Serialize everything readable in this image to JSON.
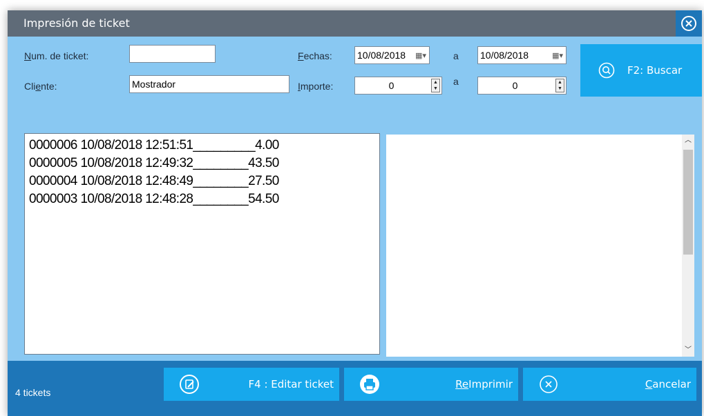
{
  "window": {
    "title": "Impresión de ticket",
    "close_icon": "close-circle-icon"
  },
  "filters": {
    "ticket_label_u": "N",
    "ticket_label_rest": "um. de ticket:",
    "ticket_value": "",
    "client_label_pre": "Cli",
    "client_label_u": "e",
    "client_label_post": "nte:",
    "client_value": "Mostrador",
    "dates_label_u": "F",
    "dates_label_rest": "echas:",
    "date_from": "10/08/2018",
    "date_to": "10/08/2018",
    "amount_label_u": "I",
    "amount_label_rest": "mporte:",
    "amount_from": "0",
    "amount_to": "0",
    "sep": "a"
  },
  "search_button": {
    "label": "F2: Buscar",
    "icon": "search-icon"
  },
  "tickets": [
    "0000006 10/08/2018 12:51:51_________4.00",
    "0000005 10/08/2018 12:49:32________43.50",
    "0000004 10/08/2018 12:48:49________27.50",
    "0000003 10/08/2018 12:48:28________54.50"
  ],
  "footer": {
    "count": "4 tickets",
    "edit_label": "F4 : Editar ticket",
    "edit_icon": "edit-icon",
    "reprint_u": "Re",
    "reprint_rest": "Imprimir",
    "reprint_icon": "printer-icon",
    "cancel_u": "C",
    "cancel_rest": "ancelar",
    "cancel_icon": "cancel-circle-icon"
  },
  "colors": {
    "panel": "#89c8f2",
    "titlebar": "#5f6b78",
    "accent": "#17a8ec",
    "footer": "#1e76b8"
  }
}
